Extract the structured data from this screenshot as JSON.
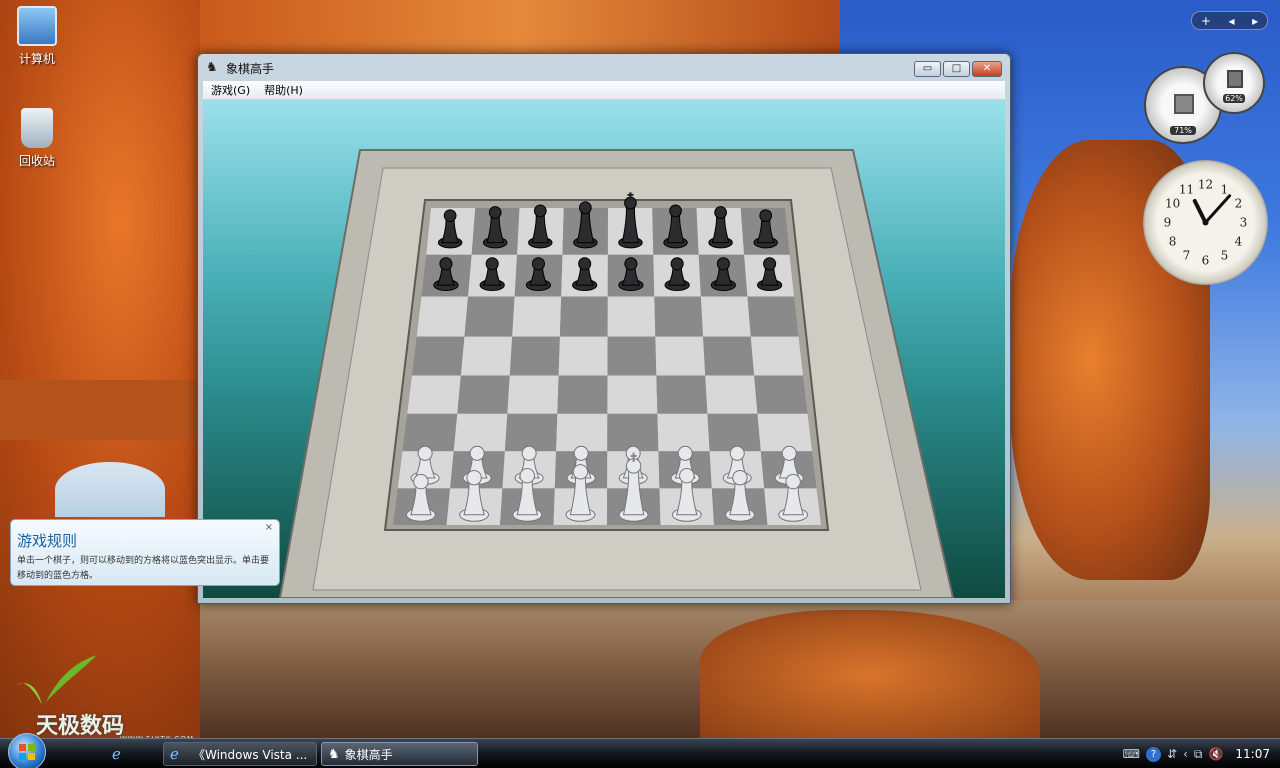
{
  "desktop": {
    "icons": [
      {
        "label": "计算机",
        "icon": "computer-icon"
      },
      {
        "label": "回收站",
        "icon": "recycle-bin-icon"
      }
    ]
  },
  "window": {
    "title": "象棋高手",
    "menu": [
      {
        "label": "游戏(G)"
      },
      {
        "label": "帮助(H)"
      }
    ],
    "controls": {
      "minimize": "▭",
      "maximize": "□",
      "close": "✕"
    }
  },
  "tip": {
    "title": "游戏规则",
    "body": "单击一个棋子，则可以移动到的方格将以蓝色突出显示。单击要移动到的蓝色方格。",
    "close": "×"
  },
  "board": {
    "black_back_rank": [
      "rook",
      "knight",
      "bishop",
      "queen",
      "king",
      "bishop",
      "knight",
      "rook"
    ],
    "white_back_rank": [
      "rook",
      "knight",
      "bishop",
      "queen",
      "king",
      "bishop",
      "knight",
      "rook"
    ]
  },
  "gadgets": {
    "cpu_percent": "71%",
    "memory_percent": "62%",
    "clock_time": "11:07",
    "clock_numbers": [
      "12",
      "1",
      "2",
      "3",
      "4",
      "5",
      "6",
      "7",
      "8",
      "9",
      "10",
      "11"
    ]
  },
  "branding": {
    "text": "天极数码",
    "url": "WWW.FLYTK.COM"
  },
  "taskbar": {
    "buttons": [
      {
        "label": "《Windows Vista ...",
        "icon": "ie-icon"
      },
      {
        "label": "象棋高手",
        "icon": "chess-icon"
      }
    ],
    "time": "11:07"
  },
  "colors": {
    "accent": "#1e5fa0",
    "board_dark": "#8a8a8a",
    "board_light": "#d8d8d8"
  }
}
